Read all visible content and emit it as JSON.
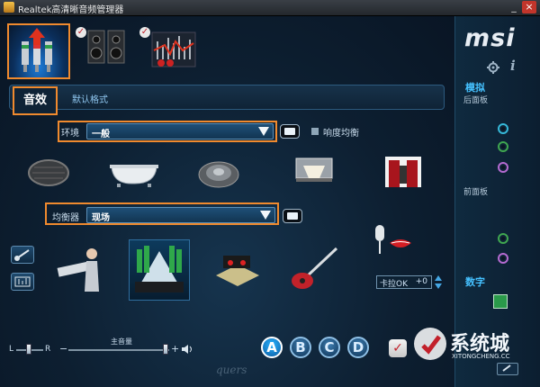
{
  "window": {
    "title": "Realtek高清晰音频管理器",
    "minimize": "_",
    "close": "×"
  },
  "brand": {
    "logo": "msi"
  },
  "tabs": {
    "sound_effects": "音效",
    "default_format": "默认格式"
  },
  "environment": {
    "label": "环境",
    "value": "一般",
    "loudness_label": "响度均衡"
  },
  "equalizer": {
    "label": "均衡器",
    "value": "现场"
  },
  "karaoke": {
    "label": "卡拉OK",
    "value": "+0"
  },
  "volume": {
    "master_label": "主音量",
    "left": "L",
    "right": "R",
    "minus": "−",
    "plus": "+"
  },
  "profiles": [
    "A",
    "B",
    "C",
    "D"
  ],
  "right_panel": {
    "analog_title": "模拟",
    "rear_panel": "后面板",
    "front_panel": "前面板",
    "digital_title": "数字"
  },
  "rear_jacks": [
    {
      "color": "#36b8d8",
      "name": "line-out"
    },
    {
      "color": "#3fa650",
      "name": "line-in-green"
    },
    {
      "color": "#b46ad0",
      "name": "mic-in"
    }
  ],
  "front_jacks": [
    {
      "color": "#3fa650",
      "name": "headphone"
    },
    {
      "color": "#b46ad0",
      "name": "front-mic"
    }
  ],
  "watermark": {
    "handwriting": "quers",
    "site_name": "系统城",
    "site_url": "XITONGCHENG.CC"
  },
  "colors": {
    "highlight": "#f08a2e",
    "accent": "#45c1ff",
    "background": "#0b1522"
  }
}
